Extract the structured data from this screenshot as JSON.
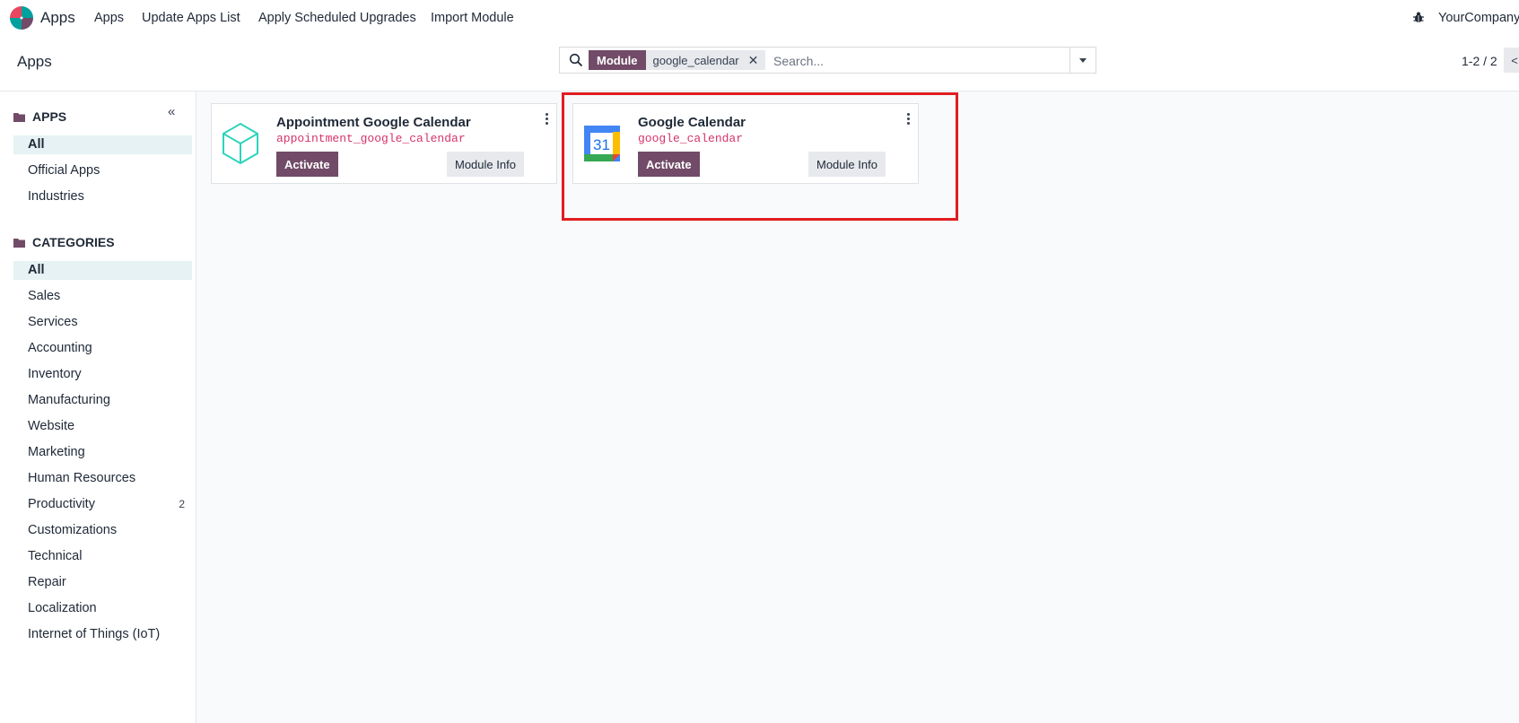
{
  "navbar": {
    "app_name": "Apps",
    "menu": [
      "Apps",
      "Update Apps List",
      "Apply Scheduled Upgrades",
      "Import Module"
    ],
    "company": "YourCompany"
  },
  "control_panel": {
    "breadcrumb": "Apps",
    "search": {
      "facet_label": "Module",
      "facet_value": "google_calendar",
      "placeholder": "Search..."
    },
    "pager": "1-2 / 2",
    "pager_prev": "<"
  },
  "sidebar": {
    "collapse": "«",
    "apps_title": "APPS",
    "apps_items": [
      "All",
      "Official Apps",
      "Industries"
    ],
    "categories_title": "CATEGORIES",
    "category_items": [
      "All",
      "Sales",
      "Services",
      "Accounting",
      "Inventory",
      "Manufacturing",
      "Website",
      "Marketing",
      "Human Resources",
      "Productivity",
      "Customizations",
      "Technical",
      "Repair",
      "Localization",
      "Internet of Things (IoT)"
    ],
    "productivity_count": "2"
  },
  "cards": [
    {
      "title": "Appointment Google Calendar",
      "technical": "appointment_google_calendar",
      "activate": "Activate",
      "info": "Module Info",
      "icon": "cube-icon"
    },
    {
      "title": "Google Calendar",
      "technical": "google_calendar",
      "activate": "Activate",
      "info": "Module Info",
      "icon": "google-calendar-icon",
      "icon_text": "31"
    }
  ],
  "colors": {
    "brand": "#714b67",
    "technical": "#d6336c",
    "highlight": "#e11d21"
  }
}
